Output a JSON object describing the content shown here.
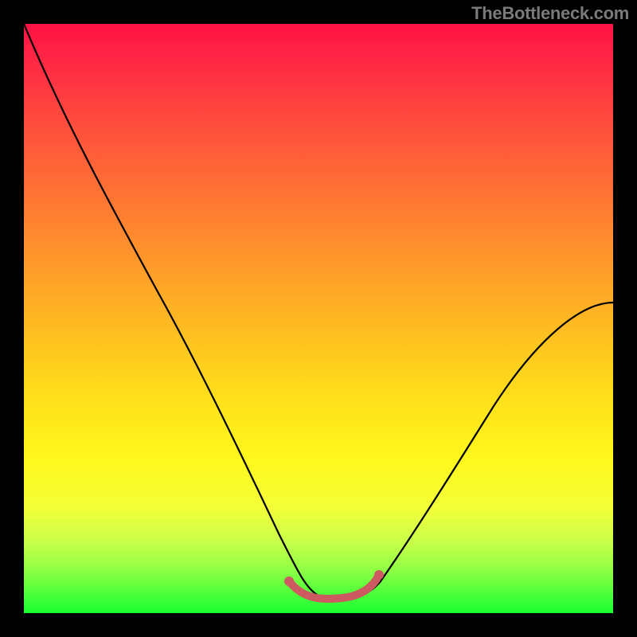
{
  "watermark": "TheBottleneck.com",
  "chart_data": {
    "type": "line",
    "title": "",
    "xlabel": "",
    "ylabel": "",
    "xlim": [
      0,
      100
    ],
    "ylim": [
      0,
      100
    ],
    "note": "Axes unlabeled; values estimated from pixel positions on a 0–100 scale. Curve drops steeply from top-left to a flat minimum near x≈48–58 at y≈3, then rises toward the right edge reaching y≈53 at x=100.",
    "series": [
      {
        "name": "main-curve",
        "x": [
          0,
          5,
          10,
          15,
          20,
          25,
          30,
          35,
          40,
          44,
          47,
          50,
          53,
          56,
          59,
          62,
          66,
          70,
          75,
          80,
          85,
          90,
          95,
          100
        ],
        "y": [
          100,
          90,
          80,
          70,
          59,
          49,
          39,
          29,
          20,
          12,
          6,
          3,
          3,
          3,
          3,
          5,
          9,
          14,
          20,
          27,
          34,
          41,
          47,
          53
        ]
      },
      {
        "name": "valley-highlight",
        "x": [
          44,
          47,
          50,
          53,
          56,
          59
        ],
        "y": [
          6,
          4,
          3,
          3,
          3,
          5
        ]
      }
    ],
    "colors": {
      "curve": "#000000",
      "valley": "#cc5a60",
      "gradient_top": "#ff1244",
      "gradient_bottom": "#1aff30"
    }
  }
}
